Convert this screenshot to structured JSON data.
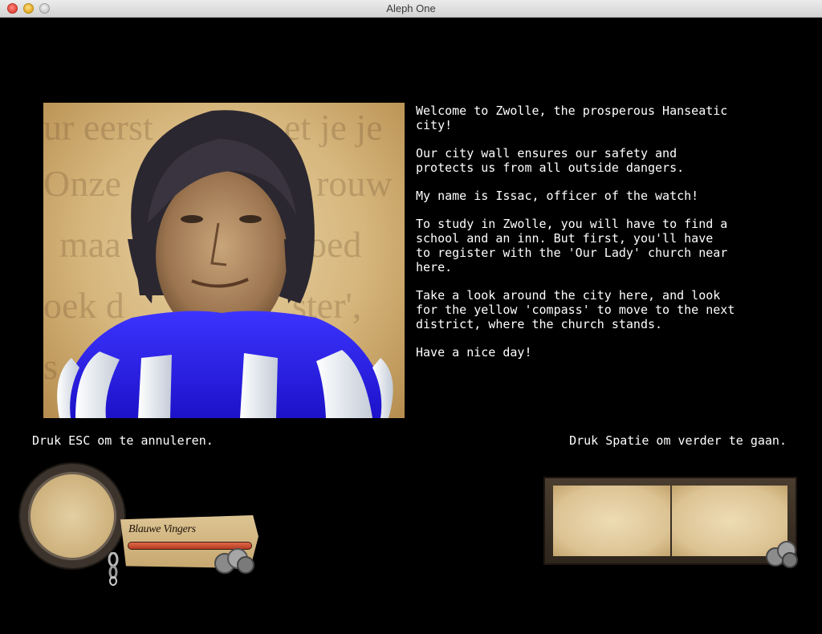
{
  "window": {
    "title": "Aleph One"
  },
  "portrait": {
    "subject": "Issac, officer of the watch",
    "background_text": [
      "ur eerst",
      "et je je",
      "Onze",
      "rouw",
      "maa",
      "oed",
      "oek d",
      "ster',",
      "s"
    ]
  },
  "dialogue": {
    "paragraphs": [
      "Welcome to Zwolle, the prosperous Hanseatic\ncity!",
      "Our city wall ensures our safety and\nprotects us from all outside dangers.",
      "My name is Issac, officer of the watch!",
      "To study in Zwolle, you will have to find a\nschool and an inn.  But first, you'll have\nto register with the 'Our Lady' church near\nhere.",
      "Take a look around the city here, and look\nfor the yellow 'compass' to move to the next\ndistrict, where the church stands.",
      "Have a nice day!"
    ]
  },
  "prompts": {
    "cancel": "Druk ESC om te annuleren.",
    "continue": "Druk Spatie om verder te gaan."
  },
  "hud": {
    "player_name": "Blauwe Vingers",
    "health_fraction": 1.0,
    "icons": {
      "portrait_frame": "ring-frame-icon",
      "chain": "chain-icon",
      "coins": "coins-icon"
    }
  },
  "colors": {
    "background": "#000000",
    "text": "#ffffff",
    "tunic_blue": "#2a1fe8",
    "parchment": "#d6b67c",
    "health_red": "#c8452a"
  }
}
